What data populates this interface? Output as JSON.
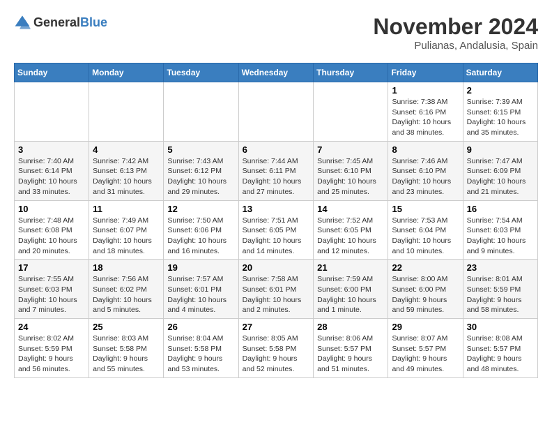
{
  "logo": {
    "general": "General",
    "blue": "Blue"
  },
  "title": "November 2024",
  "location": "Pulianas, Andalusia, Spain",
  "days_header": [
    "Sunday",
    "Monday",
    "Tuesday",
    "Wednesday",
    "Thursday",
    "Friday",
    "Saturday"
  ],
  "weeks": [
    [
      {
        "day": "",
        "info": ""
      },
      {
        "day": "",
        "info": ""
      },
      {
        "day": "",
        "info": ""
      },
      {
        "day": "",
        "info": ""
      },
      {
        "day": "",
        "info": ""
      },
      {
        "day": "1",
        "info": "Sunrise: 7:38 AM\nSunset: 6:16 PM\nDaylight: 10 hours and 38 minutes."
      },
      {
        "day": "2",
        "info": "Sunrise: 7:39 AM\nSunset: 6:15 PM\nDaylight: 10 hours and 35 minutes."
      }
    ],
    [
      {
        "day": "3",
        "info": "Sunrise: 7:40 AM\nSunset: 6:14 PM\nDaylight: 10 hours and 33 minutes."
      },
      {
        "day": "4",
        "info": "Sunrise: 7:42 AM\nSunset: 6:13 PM\nDaylight: 10 hours and 31 minutes."
      },
      {
        "day": "5",
        "info": "Sunrise: 7:43 AM\nSunset: 6:12 PM\nDaylight: 10 hours and 29 minutes."
      },
      {
        "day": "6",
        "info": "Sunrise: 7:44 AM\nSunset: 6:11 PM\nDaylight: 10 hours and 27 minutes."
      },
      {
        "day": "7",
        "info": "Sunrise: 7:45 AM\nSunset: 6:10 PM\nDaylight: 10 hours and 25 minutes."
      },
      {
        "day": "8",
        "info": "Sunrise: 7:46 AM\nSunset: 6:10 PM\nDaylight: 10 hours and 23 minutes."
      },
      {
        "day": "9",
        "info": "Sunrise: 7:47 AM\nSunset: 6:09 PM\nDaylight: 10 hours and 21 minutes."
      }
    ],
    [
      {
        "day": "10",
        "info": "Sunrise: 7:48 AM\nSunset: 6:08 PM\nDaylight: 10 hours and 20 minutes."
      },
      {
        "day": "11",
        "info": "Sunrise: 7:49 AM\nSunset: 6:07 PM\nDaylight: 10 hours and 18 minutes."
      },
      {
        "day": "12",
        "info": "Sunrise: 7:50 AM\nSunset: 6:06 PM\nDaylight: 10 hours and 16 minutes."
      },
      {
        "day": "13",
        "info": "Sunrise: 7:51 AM\nSunset: 6:05 PM\nDaylight: 10 hours and 14 minutes."
      },
      {
        "day": "14",
        "info": "Sunrise: 7:52 AM\nSunset: 6:05 PM\nDaylight: 10 hours and 12 minutes."
      },
      {
        "day": "15",
        "info": "Sunrise: 7:53 AM\nSunset: 6:04 PM\nDaylight: 10 hours and 10 minutes."
      },
      {
        "day": "16",
        "info": "Sunrise: 7:54 AM\nSunset: 6:03 PM\nDaylight: 10 hours and 9 minutes."
      }
    ],
    [
      {
        "day": "17",
        "info": "Sunrise: 7:55 AM\nSunset: 6:03 PM\nDaylight: 10 hours and 7 minutes."
      },
      {
        "day": "18",
        "info": "Sunrise: 7:56 AM\nSunset: 6:02 PM\nDaylight: 10 hours and 5 minutes."
      },
      {
        "day": "19",
        "info": "Sunrise: 7:57 AM\nSunset: 6:01 PM\nDaylight: 10 hours and 4 minutes."
      },
      {
        "day": "20",
        "info": "Sunrise: 7:58 AM\nSunset: 6:01 PM\nDaylight: 10 hours and 2 minutes."
      },
      {
        "day": "21",
        "info": "Sunrise: 7:59 AM\nSunset: 6:00 PM\nDaylight: 10 hours and 1 minute."
      },
      {
        "day": "22",
        "info": "Sunrise: 8:00 AM\nSunset: 6:00 PM\nDaylight: 9 hours and 59 minutes."
      },
      {
        "day": "23",
        "info": "Sunrise: 8:01 AM\nSunset: 5:59 PM\nDaylight: 9 hours and 58 minutes."
      }
    ],
    [
      {
        "day": "24",
        "info": "Sunrise: 8:02 AM\nSunset: 5:59 PM\nDaylight: 9 hours and 56 minutes."
      },
      {
        "day": "25",
        "info": "Sunrise: 8:03 AM\nSunset: 5:58 PM\nDaylight: 9 hours and 55 minutes."
      },
      {
        "day": "26",
        "info": "Sunrise: 8:04 AM\nSunset: 5:58 PM\nDaylight: 9 hours and 53 minutes."
      },
      {
        "day": "27",
        "info": "Sunrise: 8:05 AM\nSunset: 5:58 PM\nDaylight: 9 hours and 52 minutes."
      },
      {
        "day": "28",
        "info": "Sunrise: 8:06 AM\nSunset: 5:57 PM\nDaylight: 9 hours and 51 minutes."
      },
      {
        "day": "29",
        "info": "Sunrise: 8:07 AM\nSunset: 5:57 PM\nDaylight: 9 hours and 49 minutes."
      },
      {
        "day": "30",
        "info": "Sunrise: 8:08 AM\nSunset: 5:57 PM\nDaylight: 9 hours and 48 minutes."
      }
    ]
  ]
}
